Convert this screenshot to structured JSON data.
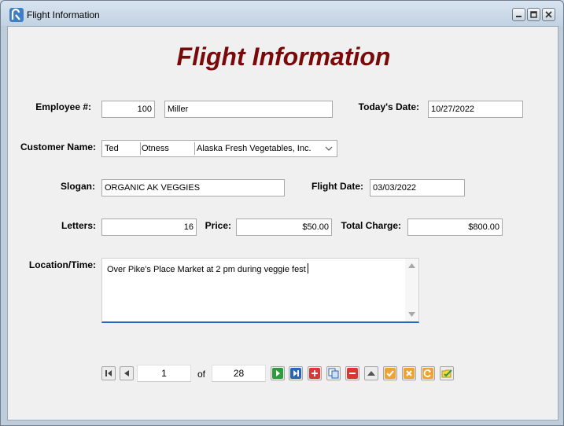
{
  "window": {
    "title": "Flight Information"
  },
  "form": {
    "heading": "Flight Information",
    "employee": {
      "label": "Employee  #:",
      "number": "100",
      "name": "Miller"
    },
    "todays_date": {
      "label": "Today's Date:",
      "value": "10/27/2022"
    },
    "customer": {
      "label": "Customer Name:",
      "first": "Ted",
      "last": "Otness",
      "company": "Alaska Fresh Vegetables, Inc."
    },
    "slogan": {
      "label": "Slogan:",
      "value": "ORGANIC AK VEGGIES"
    },
    "flight_date": {
      "label": "Flight Date:",
      "value": "03/03/2022"
    },
    "letters": {
      "label": "Letters:",
      "value": "16"
    },
    "price": {
      "label": "Price:",
      "value": "$50.00"
    },
    "total_charge": {
      "label": "Total Charge:",
      "value": "$800.00"
    },
    "location_time": {
      "label": "Location/Time:",
      "value": "Over Pike's Place Market at 2 pm during veggie fest"
    }
  },
  "navigator": {
    "current": "1",
    "of_label": "of",
    "total": "28"
  },
  "colors": {
    "heading": "#7a0a0a",
    "focus_border": "#1e6cc0"
  }
}
